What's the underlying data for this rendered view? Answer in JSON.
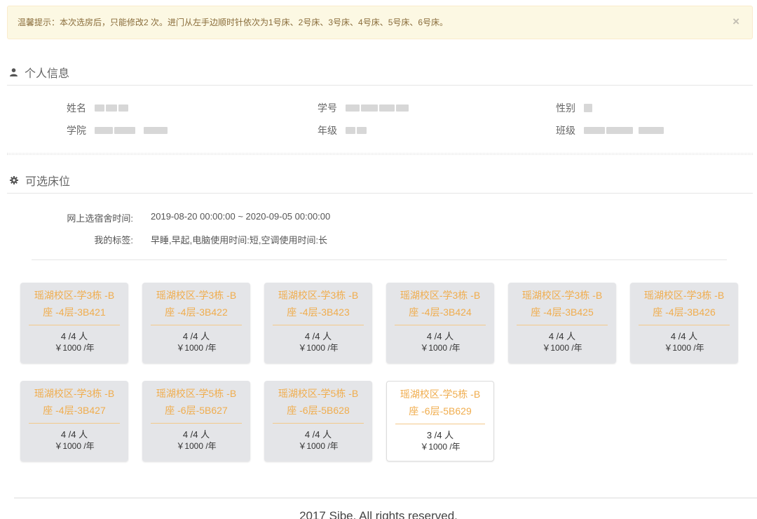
{
  "alert": {
    "text": "温馨提示：本次选房后，只能修改2 次。进门从左手边顺时针依次为1号床、2号床、3号床、4号床、5号床、6号床。",
    "close": "×"
  },
  "personal": {
    "title": "个人信息",
    "icon": "user-icon",
    "fields": [
      {
        "label": "姓名"
      },
      {
        "label": "学号"
      },
      {
        "label": "性别"
      },
      {
        "label": "学院"
      },
      {
        "label": "年级"
      },
      {
        "label": "班级"
      }
    ]
  },
  "beds": {
    "title": "可选床位",
    "icon": "gear-icon",
    "time_label": "网上选宿舍时间:",
    "time_value": "2019-08-20 00:00:00 ~ 2020-09-05 00:00:00",
    "tags_label": "我的标签:",
    "tags_value": "早睡,早起,电脑使用时间:短,空调使用时间:长",
    "rooms": [
      {
        "line1": "瑶湖校区-学3栋 -B",
        "line2": "座 -4层-3B421",
        "count": "4 /4 人",
        "price": "￥1000 /年",
        "state": "full"
      },
      {
        "line1": "瑶湖校区-学3栋 -B",
        "line2": "座 -4层-3B422",
        "count": "4 /4 人",
        "price": "￥1000 /年",
        "state": "full"
      },
      {
        "line1": "瑶湖校区-学3栋 -B",
        "line2": "座 -4层-3B423",
        "count": "4 /4 人",
        "price": "￥1000 /年",
        "state": "full"
      },
      {
        "line1": "瑶湖校区-学3栋 -B",
        "line2": "座 -4层-3B424",
        "count": "4 /4 人",
        "price": "￥1000 /年",
        "state": "full"
      },
      {
        "line1": "瑶湖校区-学3栋 -B",
        "line2": "座 -4层-3B425",
        "count": "4 /4 人",
        "price": "￥1000 /年",
        "state": "full"
      },
      {
        "line1": "瑶湖校区-学3栋 -B",
        "line2": "座 -4层-3B426",
        "count": "4 /4 人",
        "price": "￥1000 /年",
        "state": "full"
      },
      {
        "line1": "瑶湖校区-学3栋 -B",
        "line2": "座 -4层-3B427",
        "count": "4 /4 人",
        "price": "￥1000 /年",
        "state": "full"
      },
      {
        "line1": "瑶湖校区-学5栋 -B",
        "line2": "座 -6层-5B627",
        "count": "4 /4 人",
        "price": "￥1000 /年",
        "state": "full"
      },
      {
        "line1": "瑶湖校区-学5栋 -B",
        "line2": "座 -6层-5B628",
        "count": "4 /4 人",
        "price": "￥1000 /年",
        "state": "full"
      },
      {
        "line1": "瑶湖校区-学5栋 -B",
        "line2": "座 -6层-5B629",
        "count": "3 /4 人",
        "price": "￥1000 /年",
        "state": "available"
      }
    ]
  },
  "footer": {
    "text": "2017 Sibe. All rights reserved."
  },
  "colors": {
    "alert_bg": "#fcf8e3",
    "alert_text": "#8a6d3b",
    "room_name": "#f0ad4e",
    "room_full_bg": "#e4e5e8",
    "room_available_bg": "#ffffff"
  }
}
